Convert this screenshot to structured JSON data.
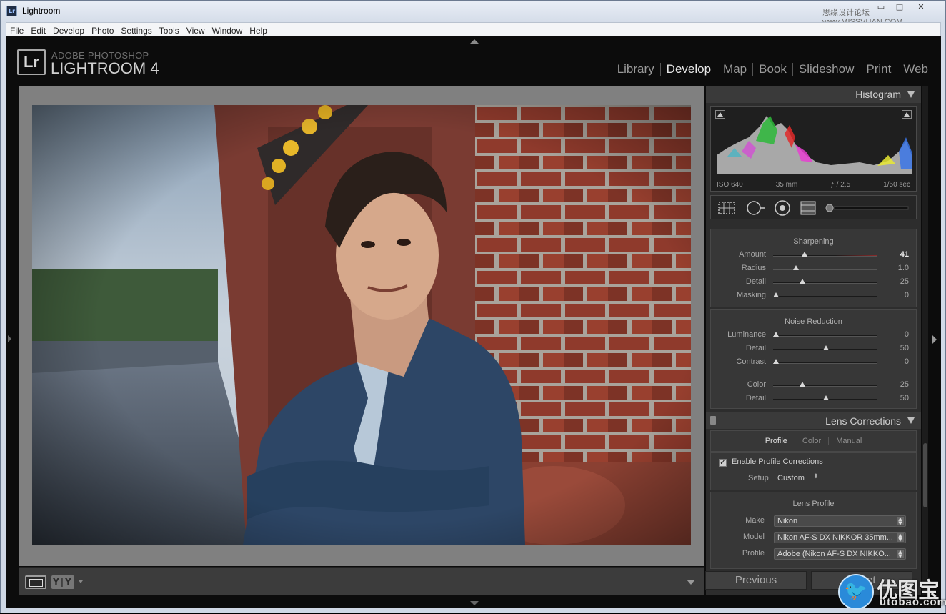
{
  "window": {
    "title": "Lightroom",
    "logo_text": "Lr",
    "watermark_top": "思缘设计论坛 www.MISSVUAN.COM",
    "controls": {
      "minimize": "▭",
      "maximize": "□",
      "close": "✕"
    }
  },
  "menu": [
    "File",
    "Edit",
    "Develop",
    "Photo",
    "Settings",
    "Tools",
    "View",
    "Window",
    "Help"
  ],
  "brand": {
    "box": "Lr",
    "line1": "ADOBE PHOTOSHOP",
    "line2": "LIGHTROOM 4"
  },
  "modules": [
    {
      "label": "Library",
      "active": false
    },
    {
      "label": "Develop",
      "active": true
    },
    {
      "label": "Map",
      "active": false
    },
    {
      "label": "Book",
      "active": false
    },
    {
      "label": "Slideshow",
      "active": false
    },
    {
      "label": "Print",
      "active": false
    },
    {
      "label": "Web",
      "active": false
    }
  ],
  "toolbar": {
    "before_after": "Y|Y"
  },
  "histogram": {
    "title": "Histogram",
    "iso": "ISO 640",
    "focal": "35 mm",
    "aperture": "ƒ / 2.5",
    "shutter": "1/50 sec"
  },
  "sharpening": {
    "title": "Sharpening",
    "sliders": [
      {
        "label": "Amount",
        "value": "41",
        "pos": 0.3,
        "bright": true
      },
      {
        "label": "Radius",
        "value": "1.0",
        "pos": 0.22,
        "bright": false
      },
      {
        "label": "Detail",
        "value": "25",
        "pos": 0.28,
        "bright": false
      },
      {
        "label": "Masking",
        "value": "0",
        "pos": 0.03,
        "bright": false
      }
    ]
  },
  "noise_reduction": {
    "title": "Noise Reduction",
    "sliders": [
      {
        "label": "Luminance",
        "value": "0",
        "pos": 0.03
      },
      {
        "label": "Detail",
        "value": "50",
        "pos": 0.51
      },
      {
        "label": "Contrast",
        "value": "0",
        "pos": 0.03
      },
      {
        "label": "Color",
        "value": "25",
        "pos": 0.28
      },
      {
        "label": "Detail",
        "value": "50",
        "pos": 0.51
      }
    ]
  },
  "lens_corrections": {
    "title": "Lens Corrections",
    "tabs": [
      {
        "label": "Profile",
        "active": true
      },
      {
        "label": "Color",
        "active": false
      },
      {
        "label": "Manual",
        "active": false
      }
    ],
    "enable_label": "Enable Profile Corrections",
    "setup_label": "Setup",
    "setup_value": "Custom",
    "lens_profile_title": "Lens Profile",
    "make_label": "Make",
    "make_value": "Nikon",
    "model_label": "Model",
    "model_value": "Nikon AF-S DX NIKKOR 35mm...",
    "profile_label": "Profile",
    "profile_value": "Adobe (Nikon AF-S DX NIKKO..."
  },
  "buttons": {
    "previous": "Previous",
    "reset": "Reset"
  },
  "watermark": {
    "line1": "优图宝",
    "line2": "utobao.com"
  },
  "colors": {
    "accent_red_track": "#8a2a2a",
    "module_active": "#e8e8e8"
  }
}
